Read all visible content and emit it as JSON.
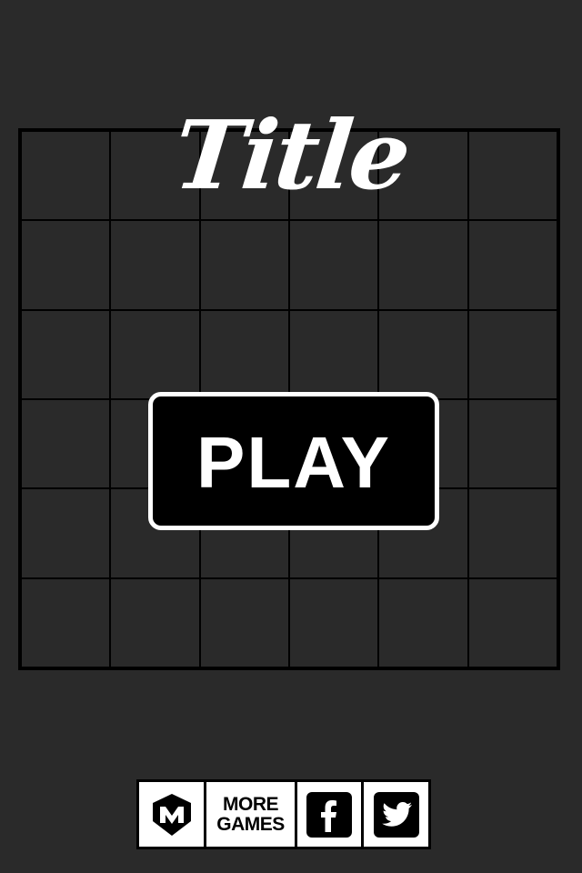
{
  "game": {
    "title": "Title",
    "play_label": "PLAY"
  },
  "board": {
    "rows": 6,
    "cols": 6
  },
  "bottom_bar": {
    "logo_icon": "m-logo-icon",
    "more_games_line1": "MORE",
    "more_games_line2": "GAMES",
    "facebook_icon": "facebook-icon",
    "twitter_icon": "twitter-icon"
  },
  "colors": {
    "background": "#2a2a2a",
    "grid_lines": "#000000",
    "button_fill": "#000000",
    "button_border": "#ffffff",
    "text": "#ffffff"
  }
}
